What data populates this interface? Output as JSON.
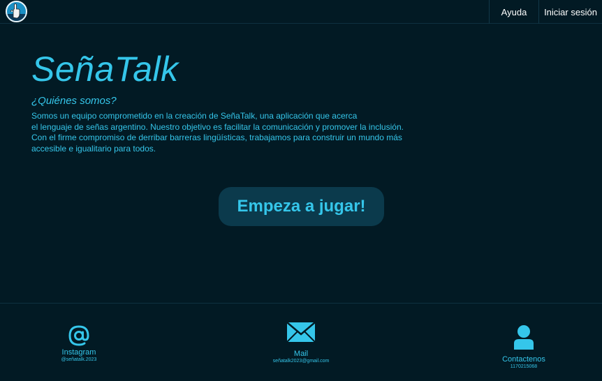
{
  "header": {
    "logo_icon": "sign-language-hand-icon",
    "nav": {
      "help_label": "Ayuda",
      "login_label": "Iniciar sesión"
    }
  },
  "hero": {
    "brand": "SeñaTalk",
    "subtitle": "¿Quiénes somos?",
    "about_lines": [
      "Somos un equipo comprometido en la creación de SeñaTalk, una aplicación que acerca",
      "el lenguaje de señas argentino. Nuestro objetivo es facilitar la comunicación y promover la inclusión.",
      "Con el firme compromiso de derribar barreras lingüísticas, trabajamos para construir un mundo más",
      "accesible e igualitario para todos."
    ],
    "play_label": "Empeza a jugar!"
  },
  "footer": {
    "instagram": {
      "icon": "at-sign-icon",
      "label": "Instagram",
      "handle": "@señatalk.2023"
    },
    "mail": {
      "icon": "envelope-icon",
      "label": "Mail",
      "address": "señatalk2023@gmail.com"
    },
    "contact": {
      "icon": "person-icon",
      "label": "Contactenos",
      "phone": "1170215068"
    }
  },
  "colors": {
    "background": "#021a24",
    "accent": "#35c6ea",
    "button_bg": "#0b3a4c"
  }
}
